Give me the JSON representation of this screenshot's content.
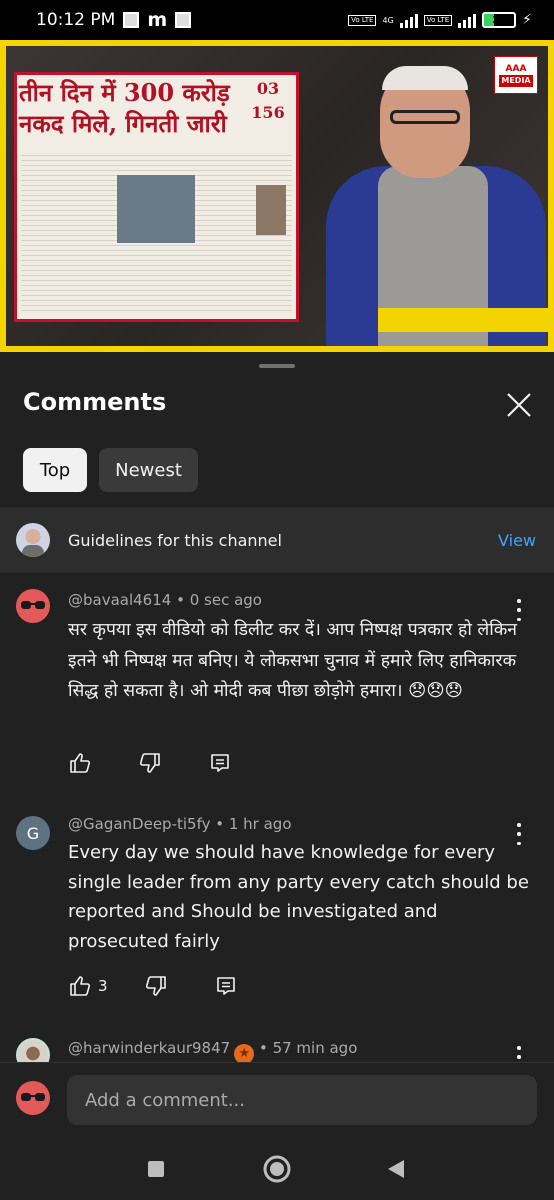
{
  "status_bar": {
    "time": "10:12 PM",
    "app_letter": "m",
    "network_label": "4G",
    "volte_label": "Vo LTE",
    "battery": "34",
    "battery_level": 0.34
  },
  "video": {
    "headline": "तीन दिन में 300 करोड़ नकद मिले, गिनती जारी",
    "side_numbers": [
      "03",
      "156"
    ],
    "logo_text": "AAA",
    "logo_sub": "MEDIA"
  },
  "comments_sheet": {
    "title": "Comments",
    "filters": [
      {
        "label": "Top",
        "selected": true
      },
      {
        "label": "Newest",
        "selected": false
      }
    ],
    "guidelines": {
      "text": "Guidelines for this channel",
      "action": "View"
    },
    "comments": [
      {
        "author": "@bavaal4614",
        "time": "0 sec ago",
        "text": "सर कृपया इस वीडियो को डिलीट कर दें। आप निष्पक्ष पत्रकार हो लेकिन इतने भी निष्पक्ष मत बनिए। ये लोकसभा चुनाव में हमारे लिए हानिकारक सिद्ध हो सकता है। ओ मोदी कब पीछा छोड़ोगे हमारा। 😞😞😞",
        "likes": ""
      },
      {
        "author": "@GaganDeep-ti5fy",
        "time": "1 hr ago",
        "avatar_letter": "G",
        "text": "Every day we should have knowledge for every single leader from any party every catch should be reported and Should be investigated and prosecuted fairly",
        "likes": "3"
      },
      {
        "author": "@harwinderkaur9847",
        "time": "57 min ago",
        "text": "",
        "likes": ""
      }
    ],
    "composer_placeholder": "Add a comment..."
  },
  "icons": [
    "close-icon",
    "more-vert-icon",
    "thumb-up-icon",
    "thumb-down-icon",
    "reply-icon",
    "nav-recents-icon",
    "nav-home-icon",
    "nav-back-icon"
  ],
  "colors": {
    "background": "#0f0f0f",
    "sheet": "#212121",
    "link": "#3ea6ff",
    "video_border": "#f4d400"
  }
}
